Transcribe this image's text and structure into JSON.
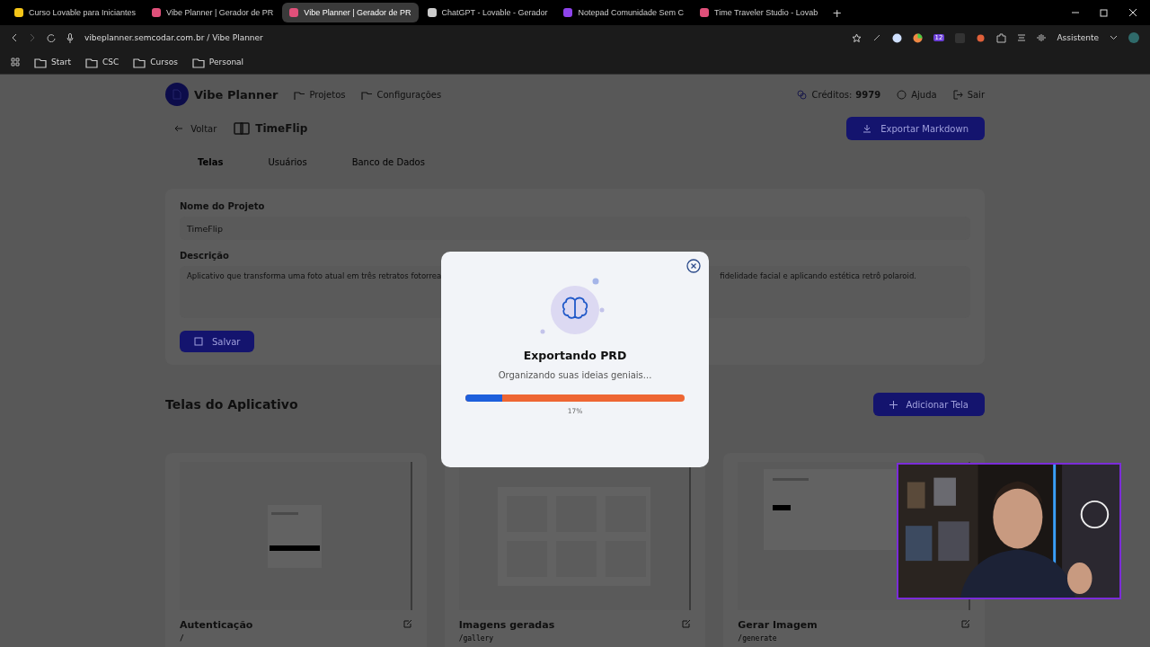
{
  "browser": {
    "tabs": [
      {
        "title": "Curso Lovable para Iniciantes",
        "selected": false,
        "color": "#f5c518"
      },
      {
        "title": "Vibe Planner | Gerador de PR",
        "selected": false,
        "color": "#e0507a"
      },
      {
        "title": "Vibe Planner | Gerador de PR",
        "selected": true,
        "color": "#e0507a"
      },
      {
        "title": "ChatGPT - Lovable - Gerador",
        "selected": false,
        "color": "#cccccc"
      },
      {
        "title": "Notepad Comunidade Sem C",
        "selected": false,
        "color": "#8e44ec"
      },
      {
        "title": "Time Traveler Studio - Lovab",
        "selected": false,
        "color": "#e0507a"
      }
    ],
    "new_tab": "+",
    "url": "vibeplanner.semcodar.com.br / Vibe Planner",
    "extension_badge": "12",
    "assistant": "Assistente",
    "bookmarks": [
      "Start",
      "CSC",
      "Cursos",
      "Personal"
    ]
  },
  "header": {
    "brand": "Vibe Planner",
    "nav": [
      "Projetos",
      "Configurações"
    ],
    "credits_label": "Créditos:",
    "credits_value": "9979",
    "help": "Ajuda",
    "logout": "Sair"
  },
  "project": {
    "back": "Voltar",
    "name": "TimeFlip",
    "export_button": "Exportar Markdown"
  },
  "tabs": [
    {
      "label": "Telas",
      "selected": true
    },
    {
      "label": "Usuários",
      "selected": false
    },
    {
      "label": "Banco de Dados",
      "selected": false
    }
  ],
  "form": {
    "name_label": "Nome do Projeto",
    "name_value": "TimeFlip",
    "description_label": "Descrição",
    "description_parts": [
      "Aplicativo que transforma uma foto atual em três retratos fotorrea",
      "fidelidade facial e aplicando estética retrô polaroid."
    ],
    "save_button": "Salvar"
  },
  "screens": {
    "title": "Telas do Aplicativo",
    "add_button": "Adicionar Tela",
    "cards": [
      {
        "name": "Autenticação",
        "route": "/"
      },
      {
        "name": "Imagens geradas",
        "route": "/gallery"
      },
      {
        "name": "Gerar Imagem",
        "route": "/generate"
      }
    ]
  },
  "modal": {
    "title": "Exportando PRD",
    "subtitle": "Organizando suas ideias geniais...",
    "level": 0.17,
    "reading": "17%"
  }
}
